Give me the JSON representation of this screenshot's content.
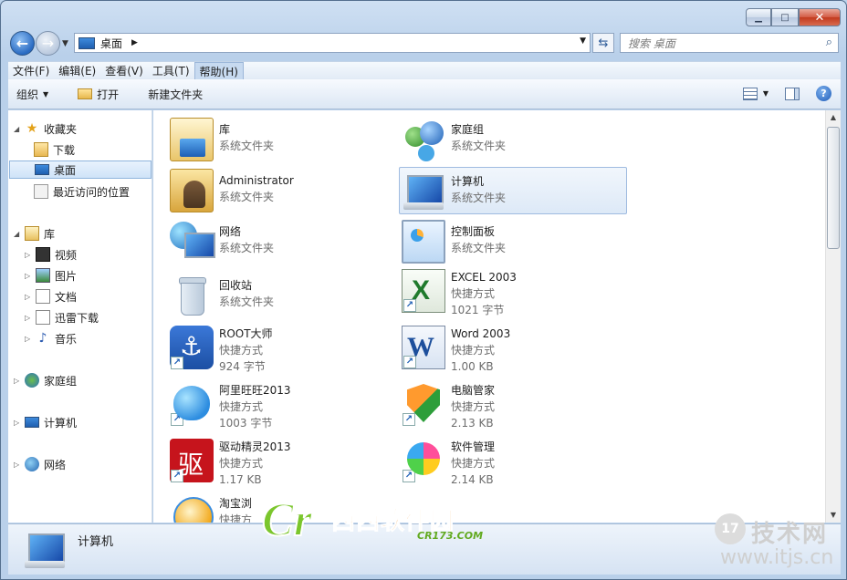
{
  "address": {
    "location": "桌面"
  },
  "search": {
    "placeholder": "搜索 桌面"
  },
  "menu": [
    "文件(F)",
    "编辑(E)",
    "查看(V)",
    "工具(T)",
    "帮助(H)"
  ],
  "toolbar": {
    "organize": "组织",
    "open": "打开",
    "new_folder": "新建文件夹"
  },
  "nav": {
    "favorites": "收藏夹",
    "downloads": "下载",
    "desktop": "桌面",
    "recent": "最近访问的位置",
    "libraries": "库",
    "videos": "视频",
    "pictures": "图片",
    "documents": "文档",
    "thunder": "迅雷下载",
    "music": "音乐",
    "homegroup": "家庭组",
    "computer": "计算机",
    "network": "网络"
  },
  "items": [
    {
      "name": "库",
      "line2": "系统文件夹",
      "line3": ""
    },
    {
      "name": "家庭组",
      "line2": "系统文件夹",
      "line3": ""
    },
    {
      "name": "Administrator",
      "line2": "系统文件夹",
      "line3": ""
    },
    {
      "name": "计算机",
      "line2": "系统文件夹",
      "line3": ""
    },
    {
      "name": "网络",
      "line2": "系统文件夹",
      "line3": ""
    },
    {
      "name": "控制面板",
      "line2": "系统文件夹",
      "line3": ""
    },
    {
      "name": "回收站",
      "line2": "系统文件夹",
      "line3": ""
    },
    {
      "name": "EXCEL 2003",
      "line2": "快捷方式",
      "line3": "1021 字节"
    },
    {
      "name": "ROOT大师",
      "line2": "快捷方式",
      "line3": "924 字节"
    },
    {
      "name": "Word 2003",
      "line2": "快捷方式",
      "line3": "1.00 KB"
    },
    {
      "name": "阿里旺旺2013",
      "line2": "快捷方式",
      "line3": "1003 字节"
    },
    {
      "name": "电脑管家",
      "line2": "快捷方式",
      "line3": "2.13 KB"
    },
    {
      "name": "驱动精灵2013",
      "line2": "快捷方式",
      "line3": "1.17 KB"
    },
    {
      "name": "软件管理",
      "line2": "快捷方式",
      "line3": "2.14 KB"
    },
    {
      "name": "淘宝浏",
      "line2": "快捷方",
      "line3": ""
    }
  ],
  "details": {
    "name": "计算机"
  },
  "watermark": {
    "cn": "西西软件园",
    "url": "CR173.COM",
    "site": "技术网",
    "site_url": "www.itjs.cn",
    "badge": "17"
  },
  "colors": {
    "selection": "#dde9f7",
    "accent": "#1d5fb5"
  }
}
